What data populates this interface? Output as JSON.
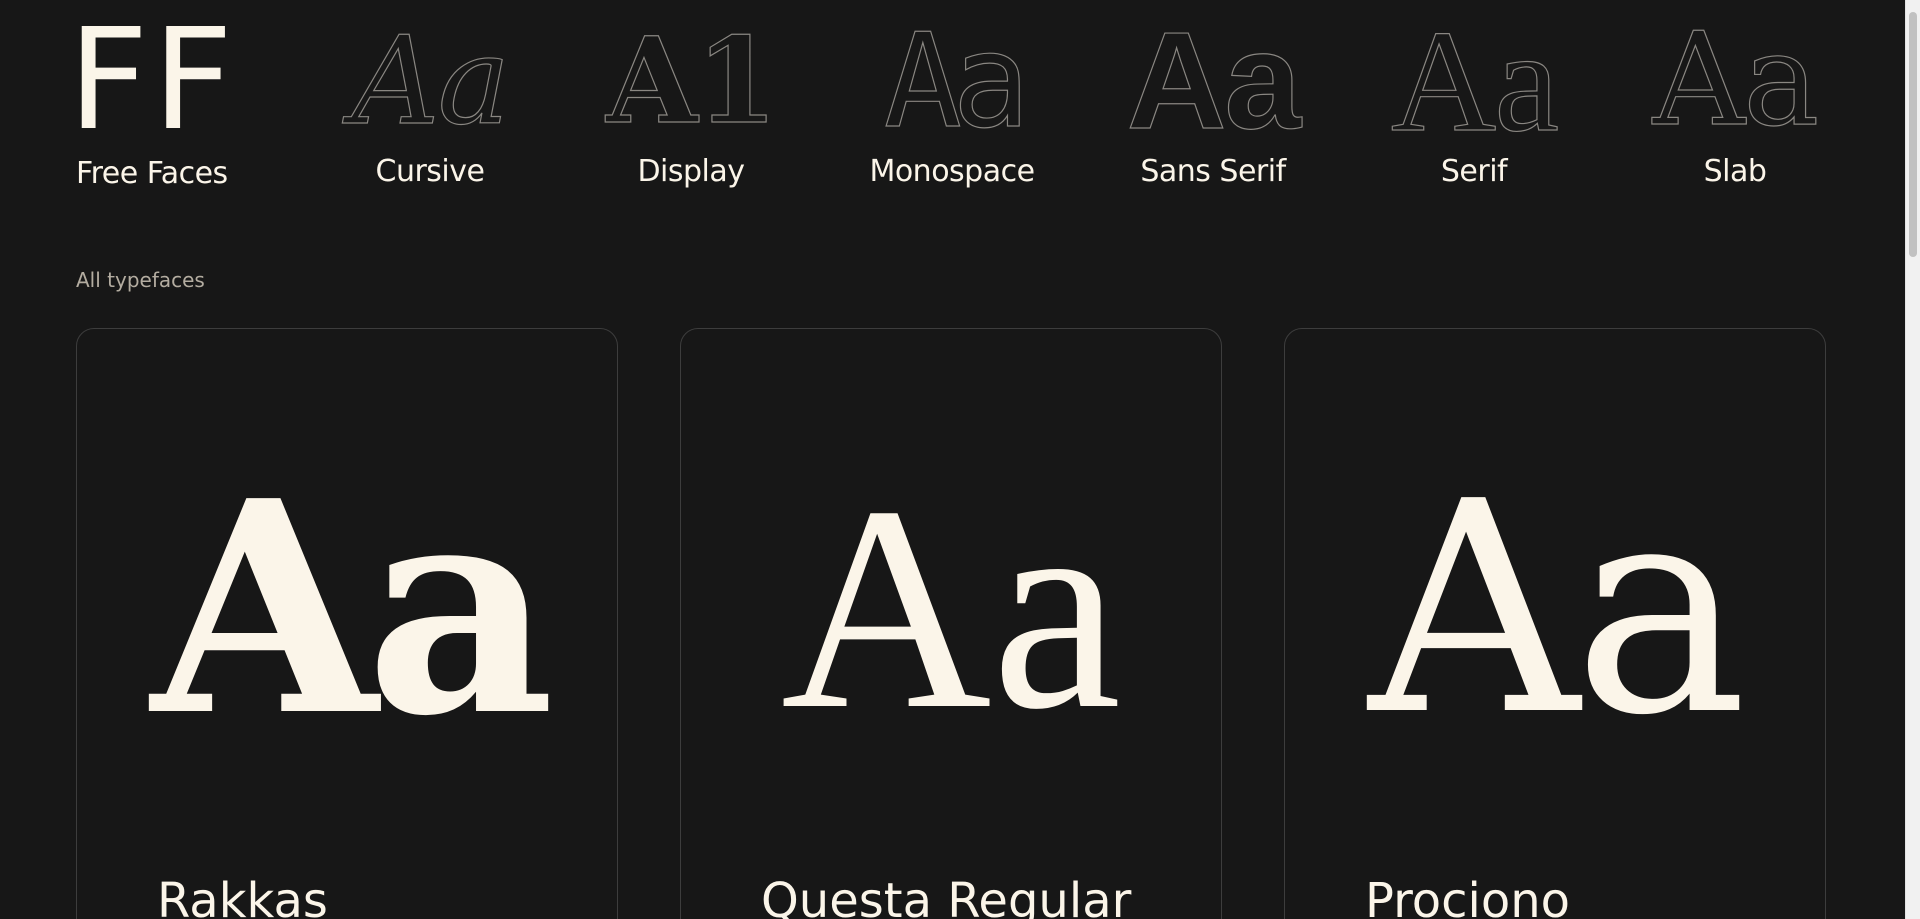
{
  "nav": {
    "logo": {
      "glyph": "FF",
      "label": "Free Faces"
    },
    "categories": [
      {
        "glyph": "Aa",
        "label": "Cursive"
      },
      {
        "glyph": "A1",
        "label": "Display"
      },
      {
        "glyph": "Aa",
        "label": "Monospace"
      },
      {
        "glyph": "Aa",
        "label": "Sans Serif"
      },
      {
        "glyph": "Aa",
        "label": "Serif"
      },
      {
        "glyph": "Aa",
        "label": "Slab"
      }
    ]
  },
  "section": {
    "label": "All typefaces"
  },
  "cards": [
    {
      "sample": "Aa",
      "name": "Rakkas"
    },
    {
      "sample": "Aa",
      "name": "Questa Regular"
    },
    {
      "sample": "Aa",
      "name": "Prociono"
    }
  ],
  "colors": {
    "background": "#171717",
    "text": "#fbf5e9",
    "muted": "#b3aca0",
    "card_border": "#3d3d3d"
  }
}
